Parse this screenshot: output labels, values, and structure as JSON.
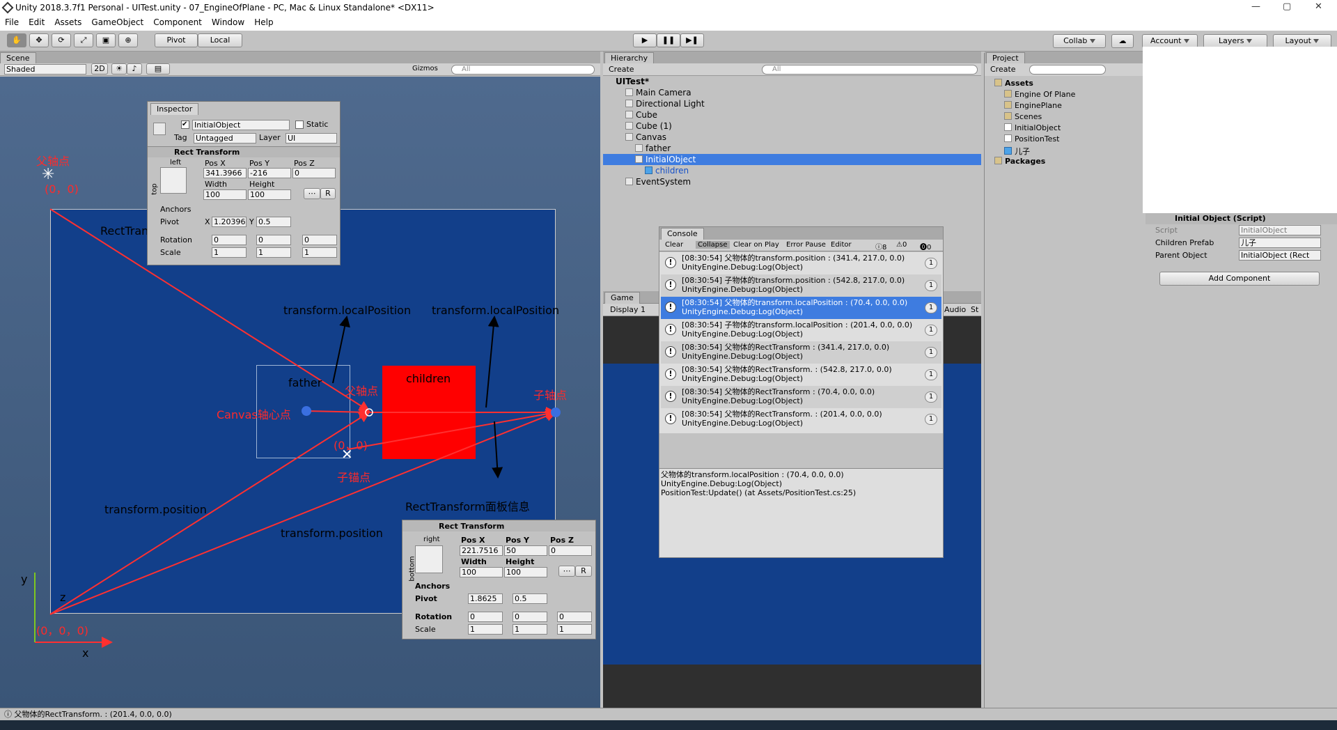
{
  "window": {
    "title": "Unity 2018.3.7f1 Personal - UITest.unity - 07_EngineOfPlane - PC, Mac & Linux Standalone* <DX11>",
    "minimize": "—",
    "maximize": "▢",
    "close": "✕"
  },
  "menu": [
    "File",
    "Edit",
    "Assets",
    "GameObject",
    "Component",
    "Window",
    "Help"
  ],
  "toolbar": {
    "pivot": "Pivot",
    "local": "Local",
    "collab": "Collab",
    "account": "Account",
    "layers": "Layers",
    "layout": "Layout"
  },
  "scene": {
    "tab": "Scene",
    "shading": "Shaded",
    "mode2d": "2D",
    "gizmos": "Gizmos",
    "search": "All"
  },
  "annotations": {
    "father_pivot": "父轴点",
    "origin_zero": "(0，0)",
    "rect_info": "RectTransform面板信息",
    "local_pos1": "transform.localPosition",
    "local_pos2": "transform.localPosition",
    "father": "father",
    "children": "children",
    "father_axis": "父轴点",
    "canvas_center": "Canvas轴心点",
    "child_axis": "子轴点",
    "zero2": "(0，0)",
    "child_anchor": "子锚点",
    "transform_pos1": "transform.position",
    "transform_pos2": "transform.position",
    "rect_info2": "RectTransform面板信息",
    "origin3": "(0，0，0)",
    "axis_x": "x",
    "axis_y": "y",
    "axis_z": "z"
  },
  "inspector_float": {
    "tab": "Inspector",
    "object_name": "InitialObject",
    "static": "Static",
    "tag_label": "Tag",
    "tag": "Untagged",
    "layer_label": "Layer",
    "layer": "UI",
    "component": "Rect Transform",
    "anchor_h": "left",
    "anchor_v": "top",
    "posx_l": "Pos X",
    "posy_l": "Pos Y",
    "posz_l": "Pos Z",
    "posx": "341.3966",
    "posy": "-216",
    "posz": "0",
    "width_l": "Width",
    "height_l": "Height",
    "width": "100",
    "height": "100",
    "anchors": "Anchors",
    "pivot": "Pivot",
    "pivot_x": "1.20396",
    "pivot_y": "0.5",
    "rotation": "Rotation",
    "rot_x": "0",
    "rot_y": "0",
    "rot_z": "0",
    "scale": "Scale",
    "sc_x": "1",
    "sc_y": "1",
    "sc_z": "1",
    "x": "X",
    "y": "Y",
    "z": "Z",
    "r": "R"
  },
  "rect_panel2": {
    "component": "Rect Transform",
    "anchor_h": "right",
    "anchor_v": "bottom",
    "posx_l": "Pos X",
    "posy_l": "Pos Y",
    "posz_l": "Pos Z",
    "posx": "221.7516",
    "posy": "50",
    "posz": "0",
    "width_l": "Width",
    "height_l": "Height",
    "width": "100",
    "height": "100",
    "anchors": "Anchors",
    "pivot": "Pivot",
    "pivot_x": "1.8625",
    "pivot_y": "0.5",
    "rotation": "Rotation",
    "rot_x": "0",
    "rot_y": "0",
    "rot_z": "0",
    "scale": "Scale",
    "sc_x": "1",
    "sc_y": "1",
    "sc_z": "1",
    "r": "R"
  },
  "hierarchy": {
    "tab": "Hierarchy",
    "create": "Create",
    "search": "All",
    "scene": "UITest*",
    "items": [
      "Main Camera",
      "Directional Light",
      "Cube",
      "Cube (1)",
      "Canvas",
      "father",
      "InitialObject",
      "children",
      "EventSystem"
    ]
  },
  "project": {
    "tab": "Project",
    "create": "Create",
    "assets": "Assets",
    "items": [
      "Engine Of Plane",
      "EnginePlane",
      "Scenes",
      "InitialObject",
      "PositionTest",
      "儿子"
    ],
    "packages": "Packages"
  },
  "console": {
    "tab": "Console",
    "clear": "Clear",
    "collapse": "Collapse",
    "clear_on_play": "Clear on Play",
    "error_pause": "Error Pause",
    "editor": "Editor",
    "n_log": "8",
    "n_warn": "0",
    "n_err": "0",
    "rows": [
      {
        "l1": "[08:30:54] 父物体的transform.position : (341.4, 217.0, 0.0)",
        "l2": "UnityEngine.Debug:Log(Object)",
        "count": "1"
      },
      {
        "l1": "[08:30:54] 子物体的transform.position : (542.8, 217.0, 0.0)",
        "l2": "UnityEngine.Debug:Log(Object)",
        "count": "1"
      },
      {
        "l1": "[08:30:54] 父物体的transform.localPosition : (70.4, 0.0, 0.0)",
        "l2": "UnityEngine.Debug:Log(Object)",
        "count": "1"
      },
      {
        "l1": "[08:30:54] 子物体的transform.localPosition : (201.4, 0.0, 0.0)",
        "l2": "UnityEngine.Debug:Log(Object)",
        "count": "1"
      },
      {
        "l1": "[08:30:54] 父物体的RectTransform : (341.4, 217.0, 0.0)",
        "l2": "UnityEngine.Debug:Log(Object)",
        "count": "1"
      },
      {
        "l1": "[08:30:54] 父物体的RectTransform. : (542.8, 217.0, 0.0)",
        "l2": "UnityEngine.Debug:Log(Object)",
        "count": "1"
      },
      {
        "l1": "[08:30:54] 父物体的RectTransform : (70.4, 0.0, 0.0)",
        "l2": "UnityEngine.Debug:Log(Object)",
        "count": "1"
      },
      {
        "l1": "[08:30:54] 父物体的RectTransform. : (201.4, 0.0, 0.0)",
        "l2": "UnityEngine.Debug:Log(Object)",
        "count": "1"
      }
    ],
    "detail": [
      "父物体的transform.localPosition : (70.4, 0.0, 0.0)",
      "UnityEngine.Debug:Log(Object)",
      "PositionTest:Update() (at Assets/PositionTest.cs:25)"
    ]
  },
  "game": {
    "tab": "Game",
    "display": "Display 1",
    "audio": "Audio",
    "st": "St"
  },
  "script_inspector": {
    "title": "Initial Object (Script)",
    "script_l": "Script",
    "script": "InitialObject",
    "prefab_l": "Children Prefab",
    "prefab": "儿子",
    "parent_l": "Parent Object",
    "parent": "InitialObject (Rect",
    "add": "Add Component"
  },
  "status": "父物体的RectTransform. : (201.4, 0.0, 0.0)"
}
